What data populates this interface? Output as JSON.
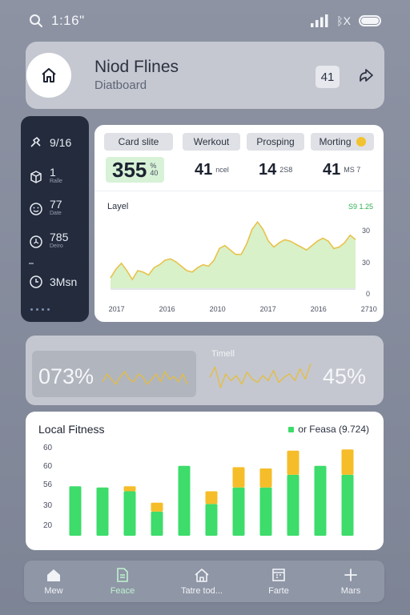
{
  "status_bar": {
    "time": "1:16\"",
    "bluetooth": "ᛒX"
  },
  "header": {
    "title": "Niod Flines",
    "subtitle": "Diatboard",
    "badge": "41"
  },
  "sidebar": {
    "items": [
      {
        "value": "9/16",
        "sub": "",
        "icon": "run-icon"
      },
      {
        "value": "1",
        "sub": "Ralle",
        "icon": "box-icon"
      },
      {
        "value": "77",
        "sub": "Date",
        "icon": "smile-icon"
      },
      {
        "value": "785",
        "sub": "Deiro",
        "icon": "timer-icon"
      },
      {
        "value": "3Msn",
        "sub": "",
        "icon": "clock-icon"
      }
    ]
  },
  "main_card": {
    "tabs": [
      {
        "label": "Card slite"
      },
      {
        "label": "Werkout"
      },
      {
        "label": "Prosping"
      },
      {
        "label": "Morting"
      }
    ],
    "stats": [
      {
        "value": "355",
        "unit_top": "%",
        "unit_bottom": "40"
      },
      {
        "value": "41",
        "unit": "ncel"
      },
      {
        "value": "14",
        "unit": "2S8"
      },
      {
        "value": "41",
        "unit": "MS 7"
      }
    ],
    "chart_title": "Layel",
    "chart_note": "S9 1.25",
    "chart_data": {
      "type": "area",
      "title": "Layel",
      "x": [
        0,
        1,
        2,
        3,
        4,
        5,
        6,
        7,
        8,
        9,
        10,
        11,
        12,
        13,
        14,
        15,
        16,
        17,
        18,
        19,
        20,
        21,
        22,
        23,
        24,
        25,
        26,
        27,
        28,
        29,
        30,
        31,
        32,
        33,
        34,
        35,
        36,
        37,
        38,
        39,
        40,
        41,
        42,
        43,
        44,
        45
      ],
      "values": [
        7,
        13,
        17,
        12,
        6,
        12,
        11,
        9,
        14,
        16,
        19,
        20,
        18,
        15,
        12,
        11,
        14,
        16,
        15,
        19,
        27,
        29,
        26,
        23,
        23,
        30,
        40,
        45,
        40,
        32,
        28,
        31,
        33,
        32,
        30,
        28,
        26,
        29,
        32,
        34,
        32,
        27,
        28,
        31,
        36,
        33
      ],
      "x_tick_labels": [
        "2017",
        "2016",
        "2010",
        "2017",
        "2016",
        "2710"
      ],
      "y_tick_labels": [
        "30",
        "30",
        "0"
      ],
      "ylim": [
        0,
        50
      ],
      "color": "#d6f0c6",
      "line_color": "#e8c24a"
    }
  },
  "summary": {
    "left_value": "073%",
    "right_label": "Timell",
    "right_value": "45%",
    "spark_left": [
      5,
      8,
      6,
      4,
      7,
      9,
      6,
      5,
      8,
      7,
      4,
      6,
      8,
      5,
      9,
      6,
      7,
      5,
      8,
      4
    ],
    "spark_right": [
      8,
      14,
      2,
      10,
      6,
      9,
      4,
      11,
      7,
      5,
      9,
      6,
      12,
      5,
      8,
      10,
      6,
      13,
      7,
      16
    ]
  },
  "bar_card": {
    "title": "Local Fitness",
    "legend": "or Feasa (9.724)",
    "chart_data": {
      "type": "bar",
      "y_tick_labels": [
        "60",
        "60",
        "56",
        "30",
        "20"
      ],
      "ylim": [
        0,
        70
      ],
      "series": [
        {
          "values": [
            39,
            38,
            35,
            19,
            55,
            25,
            38,
            38,
            48,
            55,
            48
          ],
          "color": "#3ddc6b"
        },
        {
          "values": [
            0,
            0,
            4,
            7,
            0,
            10,
            16,
            15,
            19,
            0,
            20
          ],
          "color": "#f5bd2a"
        }
      ]
    }
  },
  "bottom_nav": [
    {
      "label": "Mew",
      "icon": "home-icon"
    },
    {
      "label": "Feace",
      "icon": "document-icon"
    },
    {
      "label": "Tatre tod...",
      "icon": "house-outline-icon"
    },
    {
      "label": "Farte",
      "icon": "calendar-icon"
    },
    {
      "label": "Mars",
      "icon": "plus-icon"
    }
  ]
}
